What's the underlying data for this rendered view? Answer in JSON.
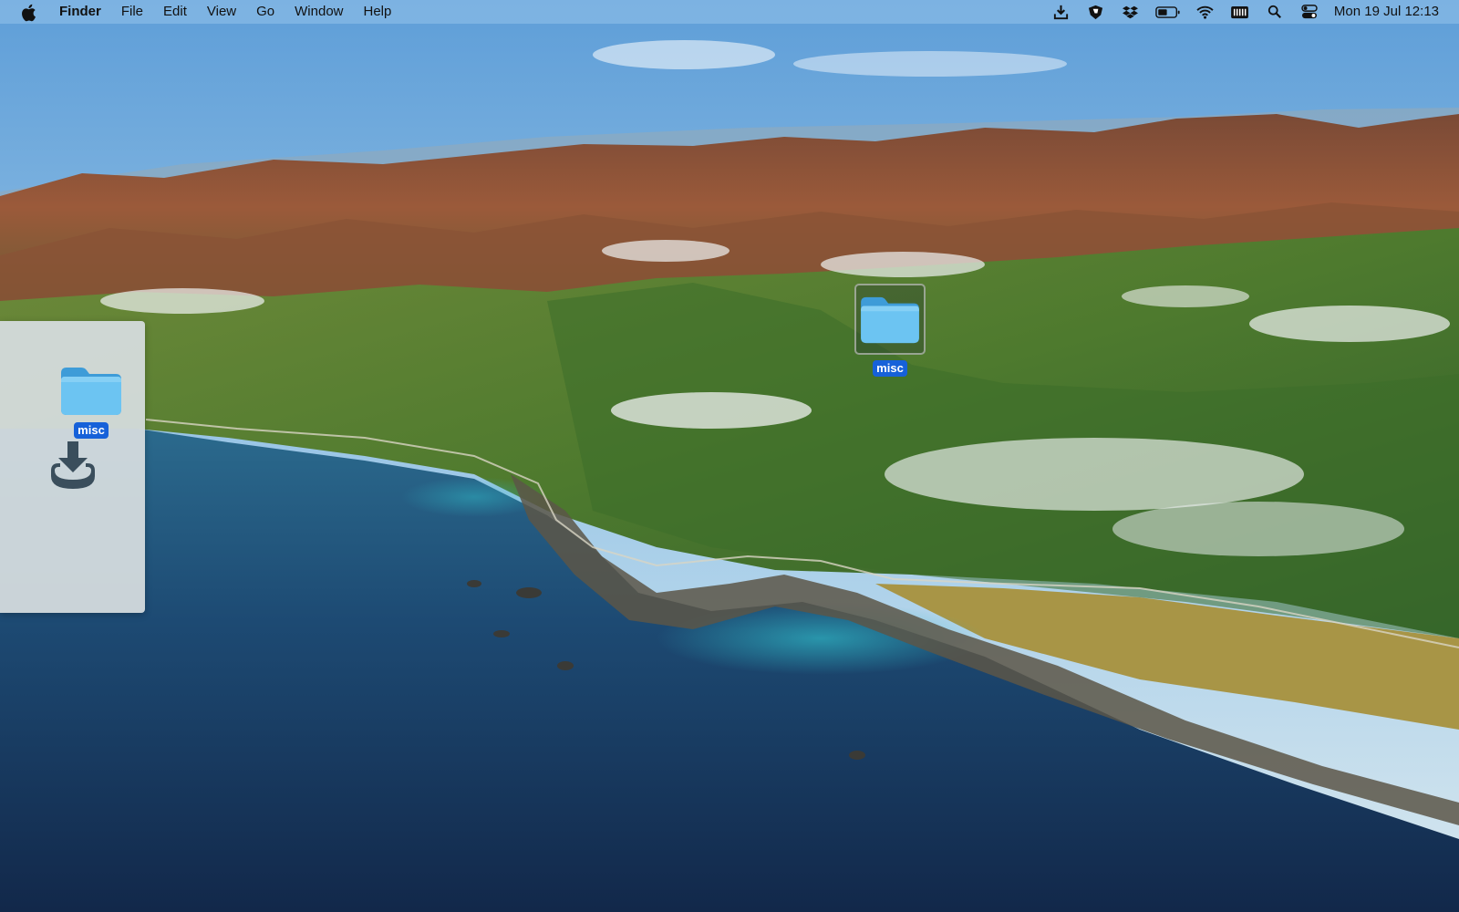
{
  "menubar": {
    "app_name": "Finder",
    "items": [
      "File",
      "Edit",
      "View",
      "Go",
      "Window",
      "Help"
    ],
    "status_icons": [
      "download-icon",
      "shield-icon",
      "dropbox-icon",
      "battery-icon",
      "wifi-icon",
      "keyboard-icon",
      "search-icon",
      "control-center-icon"
    ],
    "clock": "Mon 19 Jul  12:13"
  },
  "desktop": {
    "icons": [
      {
        "label": "misc",
        "kind": "folder",
        "selected": true
      }
    ]
  },
  "side_panel": {
    "folder_label": "misc",
    "drop_icon": "download-tray-icon"
  },
  "colors": {
    "menubar_bg": "#96c3eb",
    "selection_label": "#1661d9",
    "folder_blue": "#5bb8ee",
    "sea": "#1c3f63"
  }
}
